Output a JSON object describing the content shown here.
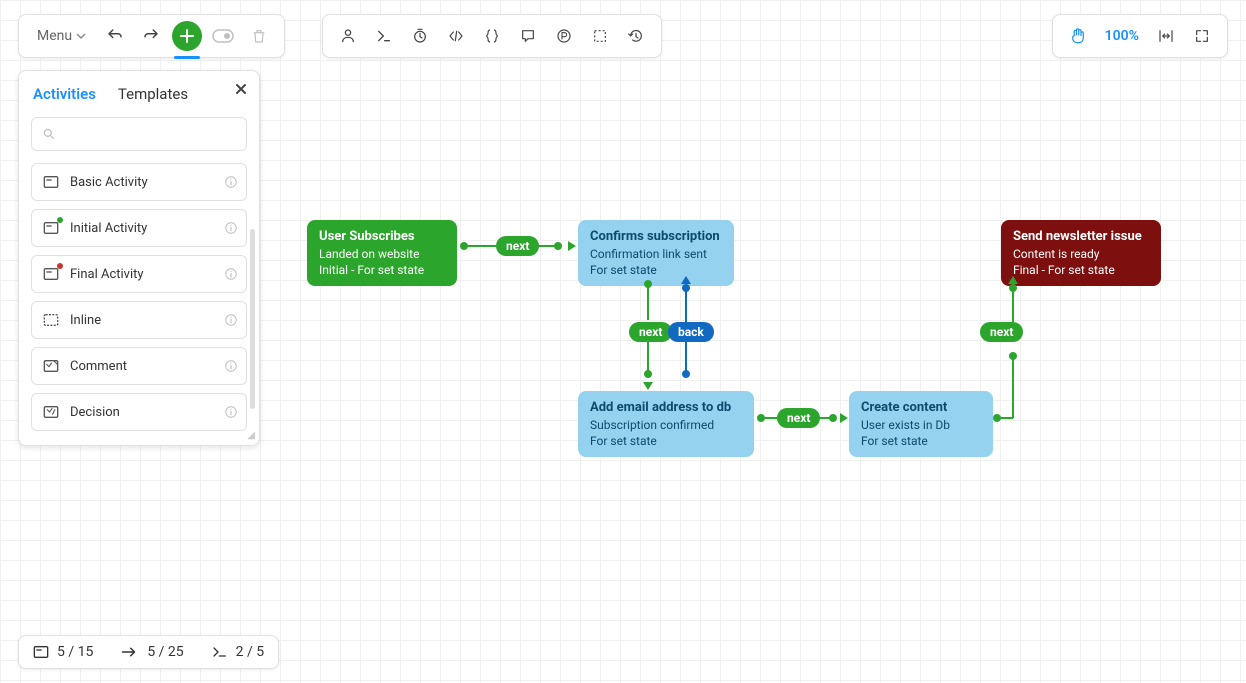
{
  "toolbar": {
    "menu_label": "Menu",
    "zoom": "100%"
  },
  "panel": {
    "tabs": {
      "activities": "Activities",
      "templates": "Templates"
    },
    "search_placeholder": "",
    "items": [
      {
        "label": "Basic Activity",
        "icon": "basic"
      },
      {
        "label": "Initial Activity",
        "icon": "initial"
      },
      {
        "label": "Final Activity",
        "icon": "final"
      },
      {
        "label": "Inline",
        "icon": "inline"
      },
      {
        "label": "Comment",
        "icon": "comment"
      },
      {
        "label": "Decision",
        "icon": "decision"
      }
    ]
  },
  "status": {
    "activities": "5 / 15",
    "transitions": "5 / 25",
    "commands": "2 / 5"
  },
  "nodes": {
    "n1": {
      "title": "User Subscribes",
      "sub1": "Landed on website",
      "sub2": "Initial - For set state"
    },
    "n2": {
      "title": "Confirms subscription",
      "sub1": "Confirmation link sent",
      "sub2": "For set state"
    },
    "n3": {
      "title": "Add email address to db",
      "sub1": "Subscription confirmed",
      "sub2": "For set state"
    },
    "n4": {
      "title": "Create content",
      "sub1": "User exists in Db",
      "sub2": "For set state"
    },
    "n5": {
      "title": "Send newsletter issue",
      "sub1": "Content is ready",
      "sub2": "Final - For set state"
    }
  },
  "edges": {
    "next": "next",
    "back": "back"
  }
}
